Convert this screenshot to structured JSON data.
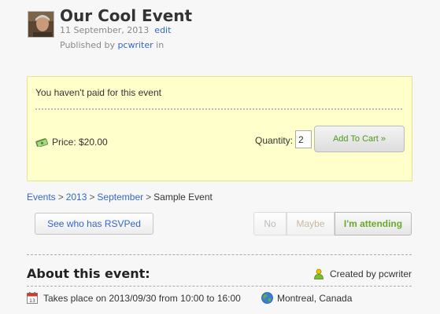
{
  "event": {
    "title": "Our Cool Event",
    "date": "11 September, 2013",
    "edit_label": "edit",
    "published_prefix": "Published by ",
    "author": "pcwriter",
    "published_suffix": " in"
  },
  "payment": {
    "unpaid_message": "You haven't paid for this event",
    "price_label": "Price: $20.00",
    "quantity_label": "Quantity:",
    "quantity_value": "2",
    "add_to_cart_label": "Add To Cart »"
  },
  "breadcrumb": {
    "items": [
      "Events",
      "2013",
      "September"
    ],
    "separator": ">",
    "current": "Sample Event"
  },
  "rsvp": {
    "see_who_label": "See who has RSVPed",
    "no_label": "No",
    "maybe_label": "Maybe",
    "attending_label": "I'm attending"
  },
  "about": {
    "title": "About this event:",
    "created_by": "Created by pcwriter",
    "takes_place": "Takes place on 2013/09/30 from 10:00 to 16:00",
    "location": "Montreal, Canada"
  },
  "icons": {
    "avatar": "user-photo",
    "price": "money-icon",
    "created_by": "user-icon",
    "date": "calendar-icon",
    "location": "globe-icon"
  },
  "colors": {
    "link": "#3366cc",
    "pay_box_bg": "#ffffcc",
    "attending": "#6aaa2a",
    "add_to_cart": "#4c9a1e"
  }
}
